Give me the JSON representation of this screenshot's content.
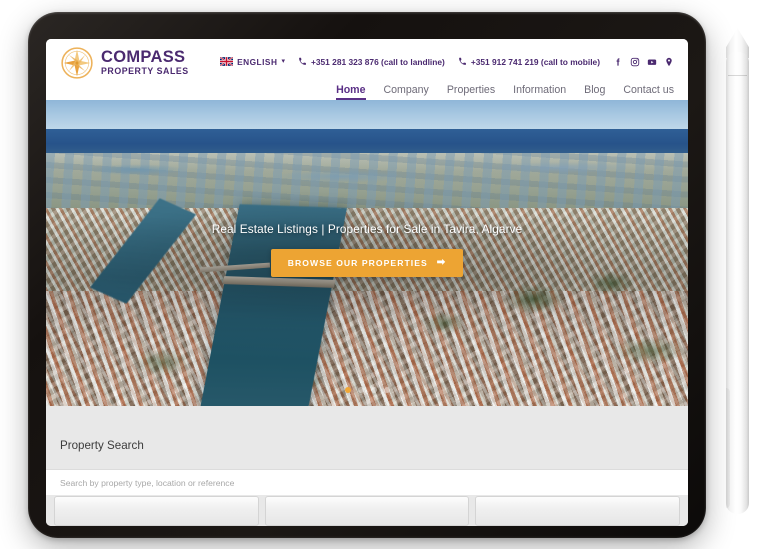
{
  "scene": {
    "device": "tablet",
    "accessory": "stylus-pen"
  },
  "brand": {
    "logo_icon": "compass-rose-icon",
    "name": "COMPASS",
    "tagline": "PROPERTY SALES",
    "color": "#4b2a70",
    "accent_color": "#eda433"
  },
  "header": {
    "language": {
      "flag_icon": "uk-flag-icon",
      "label": "ENGLISH",
      "chevron": "▾"
    },
    "phones": [
      {
        "icon": "phone-icon",
        "label": "+351 281 323 876 (call to landline)"
      },
      {
        "icon": "phone-icon",
        "label": "+351 912 741 219 (call to mobile)"
      }
    ],
    "social": [
      {
        "icon": "facebook-icon",
        "label": "Facebook"
      },
      {
        "icon": "instagram-icon",
        "label": "Instagram"
      },
      {
        "icon": "youtube-icon",
        "label": "YouTube"
      },
      {
        "icon": "location-pin-icon",
        "label": "Location"
      }
    ]
  },
  "nav": {
    "items": [
      {
        "label": "Home",
        "active": true
      },
      {
        "label": "Company",
        "active": false
      },
      {
        "label": "Properties",
        "active": false
      },
      {
        "label": "Information",
        "active": false
      },
      {
        "label": "Blog",
        "active": false
      },
      {
        "label": "Contact us",
        "active": false
      }
    ]
  },
  "hero": {
    "image_description": "Aerial view of Tavira, Algarve - river Gilao, Roman bridge, whitewashed town with terracotta roofs, salt pans and Atlantic ocean",
    "title": "Real Estate Listings | Properties for Sale in Tavira, Algarve",
    "cta_label": "BROWSE OUR PROPERTIES",
    "cta_arrow": "➡",
    "cta_color": "#eda433",
    "carousel": {
      "total": 4,
      "active_index": 0
    }
  },
  "search": {
    "title": "Property Search",
    "placeholder": "Search by property type, location or reference",
    "value": "",
    "filters": [
      {
        "label": ""
      },
      {
        "label": ""
      },
      {
        "label": ""
      }
    ]
  }
}
